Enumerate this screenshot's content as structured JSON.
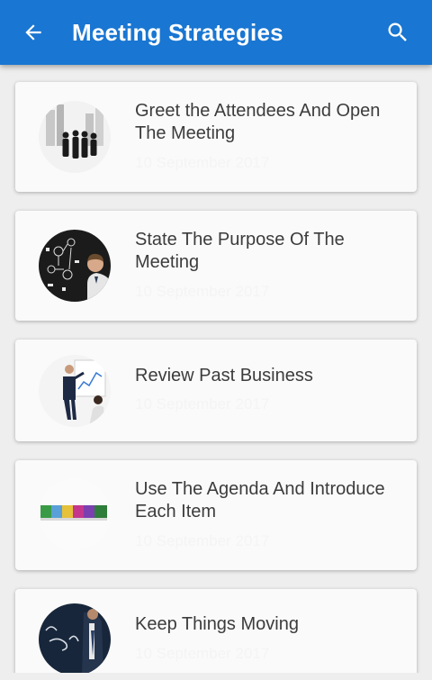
{
  "app_bar": {
    "title": "Meeting Strategies",
    "background": "#1976d2",
    "back_icon": "arrow-back-icon",
    "search_icon": "search-icon"
  },
  "articles": [
    {
      "title": "Greet the Attendees And Open The Meeting",
      "date": "10 September 2017",
      "thumbnail": "business-silhouettes-image"
    },
    {
      "title": "State The Purpose Of The Meeting",
      "date": "10 September 2017",
      "thumbnail": "ideas-businessman-image"
    },
    {
      "title": "Review Past Business",
      "date": "10 September 2017",
      "thumbnail": "presentation-whiteboard-image"
    },
    {
      "title": "Use The Agenda And Introduce Each Item",
      "date": "10 September 2017",
      "thumbnail": "colorful-blocks-image"
    },
    {
      "title": "Keep Things Moving",
      "date": "10 September 2017",
      "thumbnail": "english-chalkboard-image"
    }
  ]
}
